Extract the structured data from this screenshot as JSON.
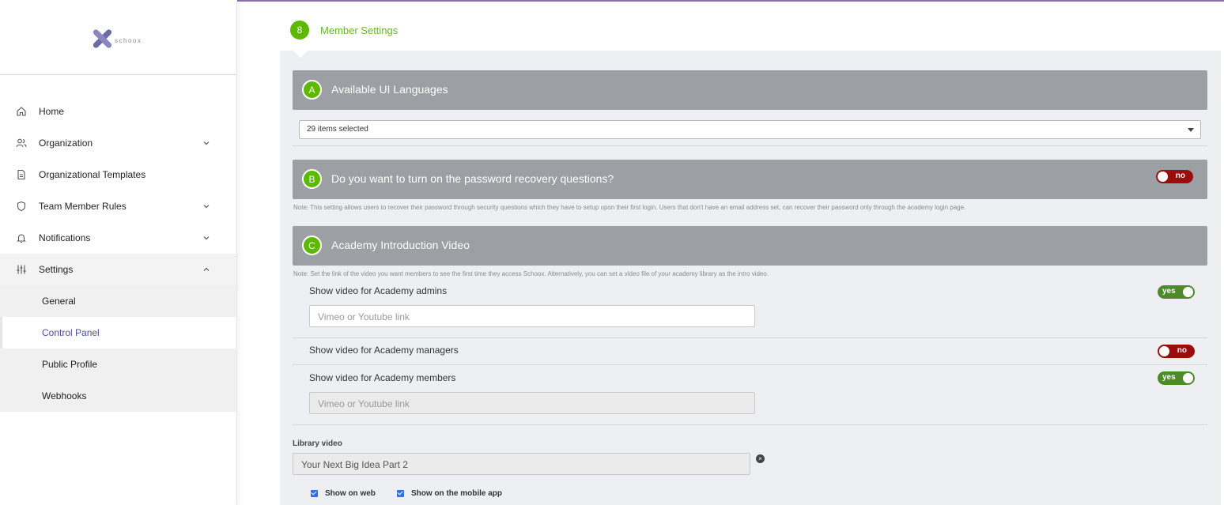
{
  "app": {
    "logo_text": "schoox",
    "brand_accent": "#5cb800",
    "brand_purple": "#8e6bb5"
  },
  "sidebar": {
    "items": [
      {
        "label": "Home",
        "icon": "home-icon"
      },
      {
        "label": "Organization",
        "icon": "users-icon",
        "expandable": true
      },
      {
        "label": "Organizational Templates",
        "icon": "document-icon"
      },
      {
        "label": "Team Member Rules",
        "icon": "shield-icon",
        "expandable": true
      },
      {
        "label": "Notifications",
        "icon": "bell-icon",
        "expandable": true
      },
      {
        "label": "Settings",
        "icon": "sliders-icon",
        "expandable": true,
        "expanded": true
      }
    ],
    "settings_sub": [
      {
        "label": "General"
      },
      {
        "label": "Control Panel",
        "active": true
      },
      {
        "label": "Public Profile"
      },
      {
        "label": "Webhooks"
      }
    ]
  },
  "main": {
    "step_number": "8",
    "title": "Member Settings",
    "sections": {
      "a": {
        "badge": "A",
        "title": "Available UI Languages",
        "select_value": "29 items selected"
      },
      "b": {
        "badge": "B",
        "title": "Do you want to turn on the password recovery questions?",
        "toggle": "no",
        "note": "Note: This setting allows users to recover their password through security questions which they have to setup upon their first login. Users that don't have an email address set, can recover their password only through the academy login page."
      },
      "c": {
        "badge": "C",
        "title": "Academy Introduction Video",
        "note": "Note: Set the link of the video you want members to see the first time they access Schoox. Alternatively, you can set a video file of your academy library as the intro video.",
        "rows": [
          {
            "label": "Show video for Academy admins",
            "toggle": "yes",
            "placeholder": "Vimeo or Youtube link"
          },
          {
            "label": "Show video for Academy managers",
            "toggle": "no"
          },
          {
            "label": "Show video for Academy members",
            "toggle": "yes",
            "placeholder": "Vimeo or Youtube link"
          }
        ]
      }
    },
    "library": {
      "label": "Library video",
      "value": "Your Next Big Idea Part 2",
      "show_on_web": "Show on web",
      "show_on_mobile": "Show on the mobile app"
    }
  }
}
